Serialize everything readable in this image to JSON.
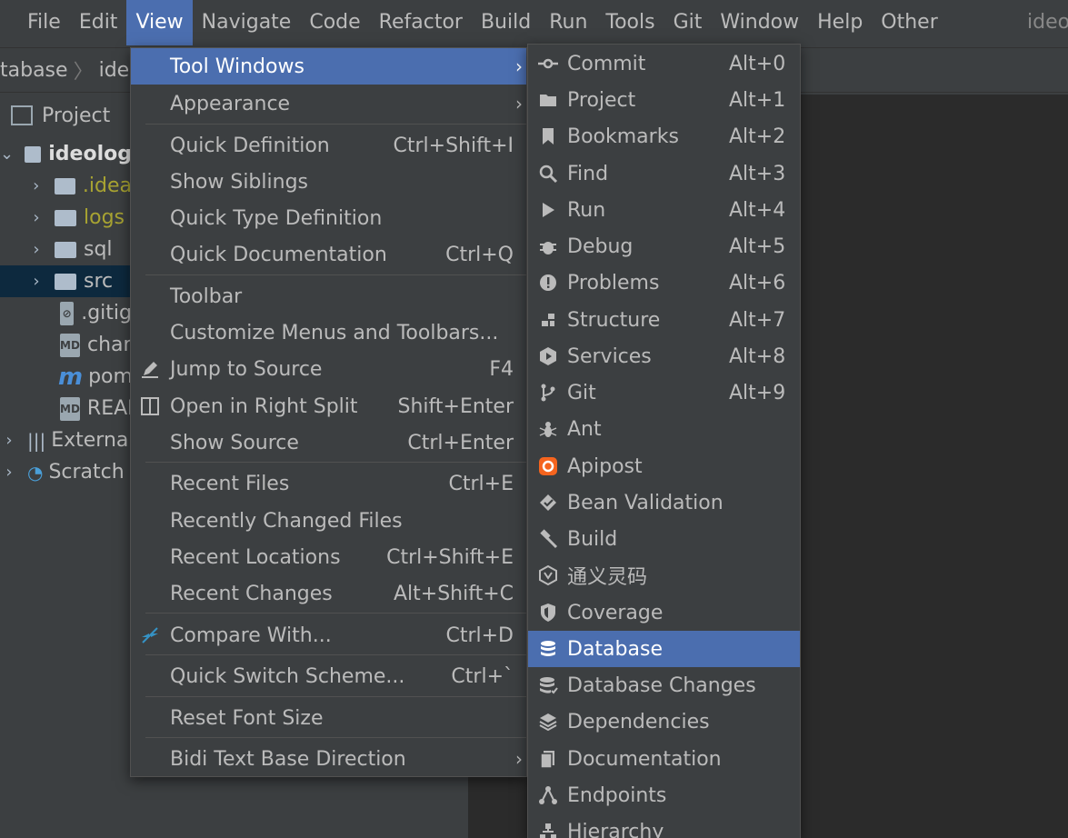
{
  "menubar": {
    "items": [
      "File",
      "Edit",
      "View",
      "Navigate",
      "Code",
      "Refactor",
      "Build",
      "Run",
      "Tools",
      "Git",
      "Window",
      "Help",
      "Other"
    ],
    "app_title": "ideo"
  },
  "breadcrumb": {
    "items": [
      "tabase",
      "ideo"
    ]
  },
  "project_panel": {
    "title": "Project",
    "tree": [
      {
        "label": "ideolog",
        "kind": "module"
      },
      {
        "label": ".idea",
        "kind": "folder"
      },
      {
        "label": "logs",
        "kind": "folder"
      },
      {
        "label": "sql",
        "kind": "folder"
      },
      {
        "label": "src",
        "kind": "folder"
      },
      {
        "label": ".gitig",
        "kind": "file"
      },
      {
        "label": "char",
        "kind": "md"
      },
      {
        "label": "pom",
        "kind": "maven"
      },
      {
        "label": "READ",
        "kind": "md"
      },
      {
        "label": "Externa",
        "kind": "libs"
      },
      {
        "label": "Scratch",
        "kind": "scratch"
      }
    ]
  },
  "view_menu": {
    "items": [
      {
        "label": "Tool Windows",
        "shortcut": "",
        "submenu": true
      },
      {
        "label": "Appearance",
        "shortcut": "",
        "submenu": true
      },
      {
        "label": "Quick Definition",
        "shortcut": "Ctrl+Shift+I"
      },
      {
        "label": "Show Siblings",
        "shortcut": ""
      },
      {
        "label": "Quick Type Definition",
        "shortcut": ""
      },
      {
        "label": "Quick Documentation",
        "shortcut": "Ctrl+Q"
      },
      {
        "label": "Toolbar",
        "shortcut": ""
      },
      {
        "label": "Customize Menus and Toolbars...",
        "shortcut": ""
      },
      {
        "label": "Jump to Source",
        "shortcut": "F4"
      },
      {
        "label": "Open in Right Split",
        "shortcut": "Shift+Enter"
      },
      {
        "label": "Show Source",
        "shortcut": "Ctrl+Enter"
      },
      {
        "label": "Recent Files",
        "shortcut": "Ctrl+E"
      },
      {
        "label": "Recently Changed Files",
        "shortcut": ""
      },
      {
        "label": "Recent Locations",
        "shortcut": "Ctrl+Shift+E"
      },
      {
        "label": "Recent Changes",
        "shortcut": "Alt+Shift+C"
      },
      {
        "label": "Compare With...",
        "shortcut": "Ctrl+D"
      },
      {
        "label": "Quick Switch Scheme...",
        "shortcut": "Ctrl+`"
      },
      {
        "label": "Reset Font Size",
        "shortcut": ""
      },
      {
        "label": "Bidi Text Base Direction",
        "shortcut": "",
        "submenu": true
      }
    ]
  },
  "tool_windows_menu": {
    "items": [
      {
        "label": "Commit",
        "shortcut": "Alt+0",
        "icon": "commit-icon"
      },
      {
        "label": "Project",
        "shortcut": "Alt+1",
        "icon": "folder-icon"
      },
      {
        "label": "Bookmarks",
        "shortcut": "Alt+2",
        "icon": "bookmark-icon"
      },
      {
        "label": "Find",
        "shortcut": "Alt+3",
        "icon": "search-icon"
      },
      {
        "label": "Run",
        "shortcut": "Alt+4",
        "icon": "play-icon"
      },
      {
        "label": "Debug",
        "shortcut": "Alt+5",
        "icon": "bug-icon"
      },
      {
        "label": "Problems",
        "shortcut": "Alt+6",
        "icon": "warning-icon"
      },
      {
        "label": "Structure",
        "shortcut": "Alt+7",
        "icon": "structure-icon"
      },
      {
        "label": "Services",
        "shortcut": "Alt+8",
        "icon": "services-icon"
      },
      {
        "label": "Git",
        "shortcut": "Alt+9",
        "icon": "git-branch-icon"
      },
      {
        "label": "Ant",
        "shortcut": "",
        "icon": "ant-icon"
      },
      {
        "label": "Apipost",
        "shortcut": "",
        "icon": "apipost-icon"
      },
      {
        "label": "Bean Validation",
        "shortcut": "",
        "icon": "bean-validation-icon"
      },
      {
        "label": "Build",
        "shortcut": "",
        "icon": "hammer-icon"
      },
      {
        "label": "通义灵码",
        "shortcut": "",
        "icon": "tongyi-icon"
      },
      {
        "label": "Coverage",
        "shortcut": "",
        "icon": "shield-icon"
      },
      {
        "label": "Database",
        "shortcut": "",
        "icon": "database-icon"
      },
      {
        "label": "Database Changes",
        "shortcut": "",
        "icon": "database-changes-icon"
      },
      {
        "label": "Dependencies",
        "shortcut": "",
        "icon": "layers-icon"
      },
      {
        "label": "Documentation",
        "shortcut": "",
        "icon": "document-icon"
      },
      {
        "label": "Endpoints",
        "shortcut": "",
        "icon": "endpoints-icon"
      },
      {
        "label": "Hierarchy",
        "shortcut": "",
        "icon": "hierarchy-icon"
      }
    ]
  },
  "colors": {
    "background": "#3c3f41",
    "highlight": "#4b6eaf",
    "editor": "#2b2b2b"
  }
}
